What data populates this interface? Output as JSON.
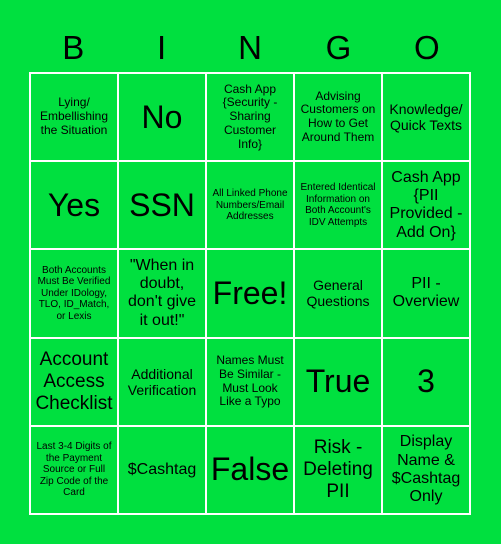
{
  "header": {
    "letters": [
      "B",
      "I",
      "N",
      "G",
      "O"
    ]
  },
  "theme": {
    "background": "#00e03f",
    "grid_line": "#ffffff",
    "text": "#000000"
  },
  "board": {
    "rows": [
      [
        "Lying/ Embellishing the Situation",
        "No",
        "Cash App {Security - Sharing Customer Info}",
        "Advising Customers on How to Get Around Them",
        "Knowledge/ Quick Texts"
      ],
      [
        "Yes",
        "SSN",
        "All Linked Phone Numbers/Email Addresses",
        "Entered Identical Information on Both Account's IDV Attempts",
        "Cash App {PII Provided - Add On}"
      ],
      [
        "Both Accounts Must Be Verified Under IDology, TLO, ID_Match, or Lexis",
        "\"When in doubt, don't give it out!\"",
        "Free!",
        "General Questions",
        "PII - Overview"
      ],
      [
        "Account Access Checklist",
        "Additional Verification",
        "Names Must Be Similar - Must Look Like a Typo",
        "True",
        "3"
      ],
      [
        "Last 3-4 Digits of the Payment Source or Full Zip Code of the Card",
        "$Cashtag",
        "False",
        "Risk - Deleting PII",
        "Display Name & $Cashtag Only"
      ]
    ]
  }
}
